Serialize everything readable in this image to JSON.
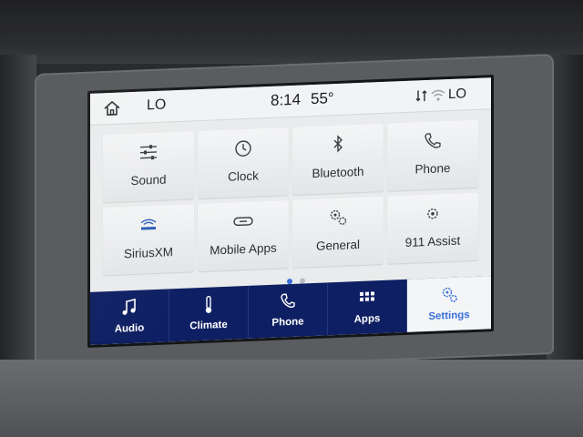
{
  "status": {
    "left_temp": "LO",
    "time": "8:14",
    "outside_temp": "55°",
    "right_temp": "LO"
  },
  "tiles": [
    {
      "label": "Sound",
      "icon": "sliders-icon"
    },
    {
      "label": "Clock",
      "icon": "clock-icon"
    },
    {
      "label": "Bluetooth",
      "icon": "bluetooth-icon"
    },
    {
      "label": "Phone",
      "icon": "phone-icon"
    },
    {
      "label": "SiriusXM",
      "icon": "siriusxm-icon"
    },
    {
      "label": "Mobile Apps",
      "icon": "link-icon"
    },
    {
      "label": "General",
      "icon": "gears-icon"
    },
    {
      "label": "911 Assist",
      "icon": "assist-icon"
    }
  ],
  "pagination": {
    "current": 1,
    "total": 2
  },
  "nav": [
    {
      "label": "Audio",
      "icon": "music-note-icon"
    },
    {
      "label": "Climate",
      "icon": "thermometer-icon"
    },
    {
      "label": "Phone",
      "icon": "phone-icon"
    },
    {
      "label": "Apps",
      "icon": "apps-grid-icon"
    },
    {
      "label": "Settings",
      "icon": "gears-icon",
      "active": true
    }
  ],
  "colors": {
    "nav_bg": "#0e1f63",
    "accent": "#3a6fd8",
    "dot_active": "#3a6fd8",
    "dot_inactive": "#b7bcc2"
  }
}
